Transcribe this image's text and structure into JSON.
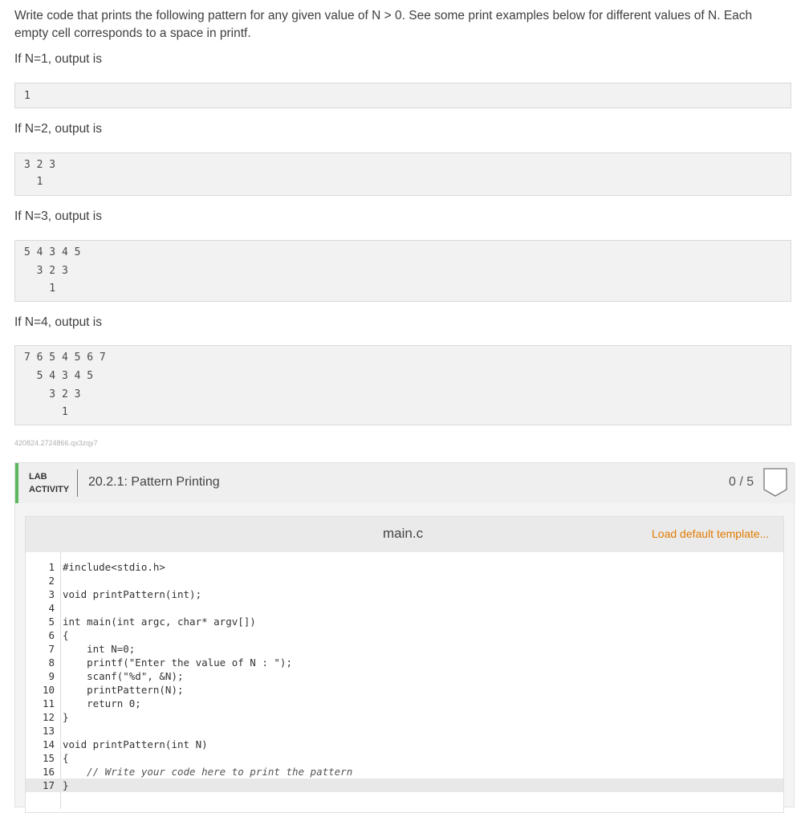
{
  "intro_text": "Write code that prints the following pattern for any given value of N > 0. See some print examples below for different values of N. Each empty cell corresponds to a space in printf.",
  "examples": [
    {
      "label": "If N=1, output is",
      "output": "1"
    },
    {
      "label": "If N=2, output is",
      "output": "3 2 3\n  1"
    },
    {
      "label": "If N=3, output is",
      "output": "5 4 3 4 5\n  3 2 3\n    1"
    },
    {
      "label": "If N=4, output is",
      "output": "7 6 5 4 5 6 7\n  5 4 3 4 5\n    3 2 3\n      1"
    }
  ],
  "caption_id": "420824.2724866.qx3zqy7",
  "lab": {
    "tag_line1": "LAB",
    "tag_line2": "ACTIVITY",
    "title": "20.2.1: Pattern Printing",
    "score": "0 / 5"
  },
  "editor": {
    "filename": "main.c",
    "load_template": "Load default template...",
    "lines": [
      "#include<stdio.h>",
      "",
      "void printPattern(int);",
      "",
      "int main(int argc, char* argv[])",
      "{",
      "    int N=0;",
      "    printf(\"Enter the value of N : \");",
      "    scanf(\"%d\", &N);",
      "    printPattern(N);",
      "    return 0;",
      "}",
      "",
      "void printPattern(int N)",
      "{",
      "    // Write your code here to print the pattern",
      "}"
    ]
  }
}
